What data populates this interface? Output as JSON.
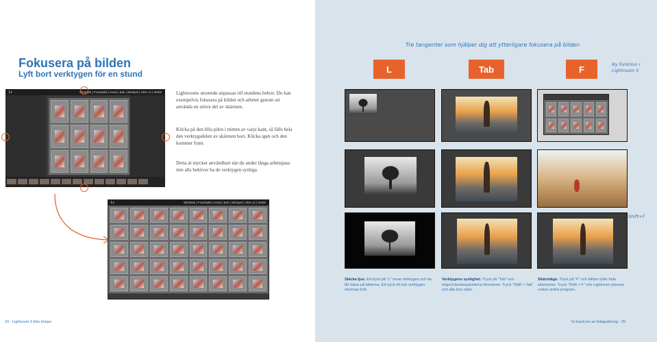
{
  "left_page": {
    "title": "Fokusera på bilden",
    "subtitle": "Lyft bort verktygen för en stund",
    "paragraphs": [
      "Lightrooms utseende anpassas till stundens behov. Du kan exempelvis fokusera på bilden och arbetet genom att använda en större del av skärmen.",
      "Klicka på den lilla pilen i mitten av varje kant, så fälls hela den verktygsdelen av skärmen bort. Klicka igen och den kommer fram.",
      "Detta är mycket användbart när du under långa arbetspass inte alls behöver ha de verktygen synliga."
    ],
    "footer": "24 · Lightroom 5 från början"
  },
  "screenshot_top": {
    "logo": "Lr",
    "modules": "Bibliotek | Framkalla | Karta | Bok | Bildspel | Skriv ut | Webb"
  },
  "screenshot_big": {
    "logo": "Lr",
    "modules": "Bibliotek | Framkalla | Karta | Bok | Bildspel | Skriv ut | Webb"
  },
  "right_page": {
    "tagline": "Tre tangenter som hjälper dig att ytterligare fokusera på bilden",
    "keys": [
      "L",
      "Tab",
      "F"
    ],
    "note_my_function": "Ny funktion i Lightroom 5",
    "note_shift_f": "Shift+F",
    "captions": [
      {
        "head": "Släcka ljus.",
        "text": "Ett tryck på \"L\" tonar verktygen och du får fokus på bilderna. Ett tryck till och verktygen slocknar helt."
      },
      {
        "head": "Verktygens synlighet.",
        "text": "Tryck på \"Tab\" och höger/vänsterpanelerna försvinner. Tryck \"Shift + Tab\" och alla fyra ryker."
      },
      {
        "head": "Skärmläge.",
        "text": "Tryck på \"F\" och bilden fyller hela skärmytan. Tryck \"Shift + F\" och Lightroom pressar undan andra program."
      }
    ],
    "footer": "Ta hand om en fotografering · 25"
  },
  "colors": {
    "accent_blue": "#2d74b6",
    "key_orange": "#e8632b",
    "right_bg": "#d9e3ec"
  }
}
